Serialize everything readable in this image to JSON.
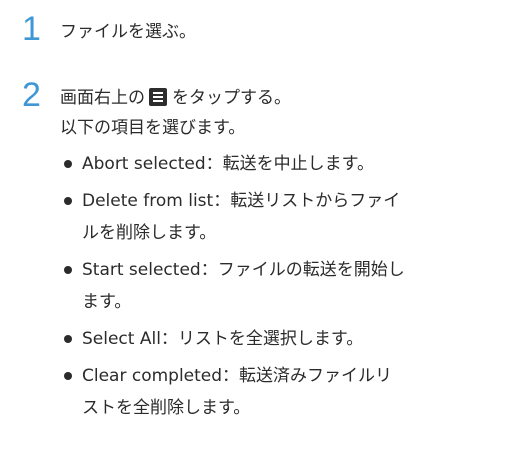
{
  "steps": [
    {
      "number": "1",
      "text": "ファイルを選ぶ。"
    },
    {
      "number": "2",
      "text_before": "画面右上の",
      "icon": "menu-icon",
      "text_after": "をタップする。",
      "intro": "以下の項目を選びます。",
      "options": [
        {
          "line1": "Abort selected：転送を中止します。",
          "line2": ""
        },
        {
          "line1": "Delete from list：転送リストからファイ",
          "line2": "ルを削除します。"
        },
        {
          "line1": "Start selected：ファイルの転送を開始し",
          "line2": "ます。"
        },
        {
          "line1": "Select All：リストを全選択します。",
          "line2": ""
        },
        {
          "line1": "Clear completed：転送済みファイルリ",
          "line2": "ストを全削除します。"
        }
      ]
    }
  ],
  "colors": {
    "step_number": "#3f97d6",
    "text": "#2b2b2b",
    "icon_bg": "#2d2d2d"
  }
}
